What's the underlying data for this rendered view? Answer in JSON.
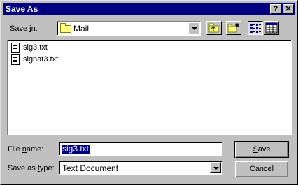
{
  "window": {
    "title": "Save As",
    "help_button": "?",
    "close_button": "✕"
  },
  "save_in": {
    "label_prefix": "Save ",
    "label_key": "i",
    "label_suffix": "n:",
    "folder": "Mail"
  },
  "toolbar": {
    "icons": [
      "up-one-level-icon",
      "create-new-folder-icon",
      "list-view-icon",
      "details-view-icon"
    ]
  },
  "files": [
    {
      "name": "sig3.txt",
      "icon": "text-file-icon"
    },
    {
      "name": "signat3.txt",
      "icon": "text-file-icon"
    }
  ],
  "file_name": {
    "label_prefix": "File ",
    "label_key": "n",
    "label_suffix": "ame:",
    "value": "sig3.txt"
  },
  "save_as_type": {
    "label_prefix": "Save as ",
    "label_key": "t",
    "label_suffix": "ype:",
    "value": "Text Document"
  },
  "buttons": {
    "save_key": "S",
    "save_rest": "ave",
    "cancel": "Cancel"
  },
  "colors": {
    "titlebar": "#000080",
    "face": "#c0c0c0",
    "folder": "#ffff80"
  }
}
